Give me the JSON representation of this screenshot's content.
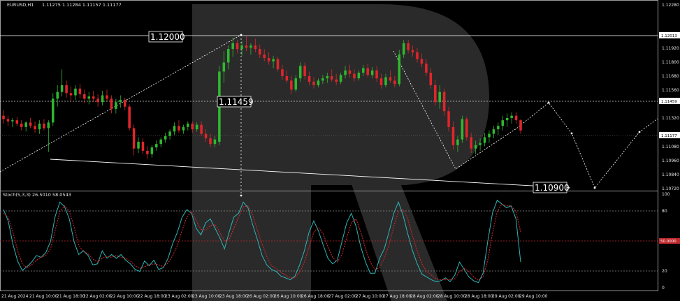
{
  "header": {
    "symbol": "EURUSD,H1",
    "ohlc": "1.11275  1.11284  1.11157  1.11177"
  },
  "indicator": {
    "label": "Stoch(5,3,3) 26.5010 58.0543"
  },
  "price_axis": {
    "ticks": [
      "1.12280",
      "1.12013",
      "1.11920",
      "1.11800",
      "1.11680",
      "1.11560",
      "1.11459",
      "1.11320",
      "1.11177",
      "1.11080",
      "1.10960",
      "1.10840",
      "1.10720"
    ]
  },
  "stoch_axis": {
    "ticks": [
      "100",
      "80",
      "50.0000",
      "20",
      "0"
    ]
  },
  "time_axis": {
    "labels": [
      "21 Aug 2024",
      "21 Aug 10:00",
      "21 Aug 18:00",
      "22 Aug 02:00",
      "22 Aug 10:00",
      "22 Aug 18:00",
      "23 Aug 02:00",
      "23 Aug 10:00",
      "23 Aug 18:00",
      "26 Aug 02:00",
      "26 Aug 10:00",
      "26 Aug 18:00",
      "27 Aug 02:00",
      "27 Aug 10:00",
      "27 Aug 18:00",
      "28 Aug 02:00",
      "28 Aug 10:00",
      "28 Aug 18:00",
      "29 Aug 02:00",
      "29 Aug 10:00"
    ]
  },
  "annotations": {
    "level_high": "1.12000",
    "level_mid": "1.11459",
    "level_low": "1.10900"
  },
  "colors": {
    "background": "#000000",
    "bull": "#2fb82f",
    "bear": "#e0262b",
    "stoch_main": "#2fb5b8",
    "stoch_signal": "#e0262b",
    "current_price_tag": "#ffffff",
    "watermark": "#2a2a2a"
  },
  "chart_data": [
    {
      "type": "candlestick",
      "title": "EURUSD,H1",
      "ylim": [
        1.1066,
        1.1232
      ],
      "levels": [
        1.12013,
        1.11459,
        1.11177
      ],
      "candles": [
        [
          1.1131,
          1.1136,
          1.1124,
          1.1128
        ],
        [
          1.1128,
          1.1131,
          1.1122,
          1.1126
        ],
        [
          1.1126,
          1.1129,
          1.1121,
          1.1127
        ],
        [
          1.1127,
          1.113,
          1.1122,
          1.1124
        ],
        [
          1.1124,
          1.1127,
          1.1118,
          1.1121
        ],
        [
          1.1121,
          1.1126,
          1.1117,
          1.1125
        ],
        [
          1.1125,
          1.1129,
          1.112,
          1.1122
        ],
        [
          1.1122,
          1.1126,
          1.1116,
          1.1119
        ],
        [
          1.1119,
          1.1127,
          1.1115,
          1.1124
        ],
        [
          1.1124,
          1.1128,
          1.1118,
          1.112
        ],
        [
          1.112,
          1.1127,
          1.1099,
          1.1125
        ],
        [
          1.1125,
          1.1151,
          1.1122,
          1.1146
        ],
        [
          1.1146,
          1.1158,
          1.1139,
          1.1152
        ],
        [
          1.1152,
          1.1172,
          1.1148,
          1.1158
        ],
        [
          1.1158,
          1.1162,
          1.1147,
          1.1151
        ],
        [
          1.1151,
          1.1157,
          1.1144,
          1.1149
        ],
        [
          1.1149,
          1.1158,
          1.1145,
          1.1155
        ],
        [
          1.1155,
          1.1159,
          1.1146,
          1.115
        ],
        [
          1.115,
          1.1154,
          1.1142,
          1.1146
        ],
        [
          1.1146,
          1.1152,
          1.1141,
          1.1148
        ],
        [
          1.1148,
          1.1153,
          1.1143,
          1.1146
        ],
        [
          1.1146,
          1.115,
          1.1139,
          1.1143
        ],
        [
          1.1143,
          1.1153,
          1.114,
          1.1149
        ],
        [
          1.1149,
          1.1154,
          1.1144,
          1.1146
        ],
        [
          1.1146,
          1.1149,
          1.1133,
          1.1137
        ],
        [
          1.1137,
          1.1146,
          1.1133,
          1.1143
        ],
        [
          1.1143,
          1.1149,
          1.1138,
          1.1145
        ],
        [
          1.1145,
          1.1147,
          1.1136,
          1.1139
        ],
        [
          1.1139,
          1.1141,
          1.1118,
          1.112
        ],
        [
          1.112,
          1.1123,
          1.1096,
          1.1102
        ],
        [
          1.1102,
          1.1112,
          1.1098,
          1.1108
        ],
        [
          1.1108,
          1.1111,
          1.1097,
          1.11
        ],
        [
          1.11,
          1.1104,
          1.1093,
          1.1097
        ],
        [
          1.1097,
          1.1105,
          1.1094,
          1.1103
        ],
        [
          1.1103,
          1.1109,
          1.11,
          1.1106
        ],
        [
          1.1106,
          1.1112,
          1.1103,
          1.111
        ],
        [
          1.111,
          1.1116,
          1.1107,
          1.1113
        ],
        [
          1.1113,
          1.1119,
          1.111,
          1.1117
        ],
        [
          1.1117,
          1.1125,
          1.1114,
          1.1122
        ],
        [
          1.1122,
          1.1127,
          1.1116,
          1.1118
        ],
        [
          1.1118,
          1.1123,
          1.1115,
          1.1121
        ],
        [
          1.1121,
          1.1126,
          1.1118,
          1.1124
        ],
        [
          1.1124,
          1.1126,
          1.1116,
          1.1119
        ],
        [
          1.1119,
          1.1125,
          1.1117,
          1.1123
        ],
        [
          1.1123,
          1.1126,
          1.1113,
          1.1115
        ],
        [
          1.1115,
          1.1119,
          1.1108,
          1.1111
        ],
        [
          1.1111,
          1.1115,
          1.1103,
          1.1106
        ],
        [
          1.1106,
          1.1113,
          1.1103,
          1.111
        ],
        [
          1.1108,
          1.1175,
          1.1105,
          1.117
        ],
        [
          1.117,
          1.1188,
          1.116,
          1.1178
        ],
        [
          1.1178,
          1.1193,
          1.1172,
          1.119
        ],
        [
          1.119,
          1.12,
          1.1183,
          1.1195
        ],
        [
          1.1195,
          1.1198,
          1.1186,
          1.119
        ],
        [
          1.119,
          1.1197,
          1.1184,
          1.1193
        ],
        [
          1.1193,
          1.1201,
          1.1188,
          1.1191
        ],
        [
          1.1191,
          1.1195,
          1.1185,
          1.1193
        ],
        [
          1.1193,
          1.1199,
          1.1187,
          1.119
        ],
        [
          1.119,
          1.1194,
          1.1182,
          1.1185
        ],
        [
          1.1185,
          1.119,
          1.1179,
          1.1182
        ],
        [
          1.1182,
          1.1187,
          1.1176,
          1.1179
        ],
        [
          1.1179,
          1.1184,
          1.1173,
          1.1181
        ],
        [
          1.1181,
          1.1183,
          1.117,
          1.1172
        ],
        [
          1.1172,
          1.1176,
          1.1163,
          1.1166
        ],
        [
          1.1166,
          1.1171,
          1.116,
          1.1162
        ],
        [
          1.1162,
          1.1166,
          1.115,
          1.1154
        ],
        [
          1.1154,
          1.1167,
          1.1152,
          1.1164
        ],
        [
          1.1164,
          1.1178,
          1.1161,
          1.1175
        ],
        [
          1.1175,
          1.1178,
          1.1163,
          1.1166
        ],
        [
          1.1166,
          1.117,
          1.1158,
          1.1161
        ],
        [
          1.1161,
          1.1165,
          1.1155,
          1.1158
        ],
        [
          1.1158,
          1.1164,
          1.1156,
          1.1162
        ],
        [
          1.1162,
          1.1167,
          1.1159,
          1.1164
        ],
        [
          1.1164,
          1.1169,
          1.116,
          1.1166
        ],
        [
          1.1166,
          1.1172,
          1.1161,
          1.1163
        ],
        [
          1.1163,
          1.1168,
          1.1158,
          1.1161
        ],
        [
          1.1161,
          1.1169,
          1.1159,
          1.1167
        ],
        [
          1.1167,
          1.1175,
          1.1164,
          1.1171
        ],
        [
          1.1171,
          1.1176,
          1.1165,
          1.1168
        ],
        [
          1.1168,
          1.1172,
          1.1161,
          1.1164
        ],
        [
          1.1164,
          1.1171,
          1.1162,
          1.1169
        ],
        [
          1.1169,
          1.1176,
          1.1166,
          1.1173
        ],
        [
          1.1173,
          1.1177,
          1.1165,
          1.1167
        ],
        [
          1.1167,
          1.1174,
          1.1164,
          1.1171
        ],
        [
          1.1171,
          1.1175,
          1.1161,
          1.1164
        ],
        [
          1.1164,
          1.1168,
          1.1155,
          1.1158
        ],
        [
          1.1158,
          1.1168,
          1.1156,
          1.1165
        ],
        [
          1.1165,
          1.1171,
          1.116,
          1.1162
        ],
        [
          1.1162,
          1.1166,
          1.1156,
          1.1159
        ],
        [
          1.1159,
          1.1189,
          1.1157,
          1.1185
        ],
        [
          1.1185,
          1.1198,
          1.1182,
          1.1195
        ],
        [
          1.1195,
          1.1198,
          1.1186,
          1.1189
        ],
        [
          1.1189,
          1.1193,
          1.1183,
          1.1187
        ],
        [
          1.1187,
          1.1191,
          1.1178,
          1.1181
        ],
        [
          1.1181,
          1.1186,
          1.1174,
          1.1177
        ],
        [
          1.1177,
          1.1181,
          1.1166,
          1.1169
        ],
        [
          1.1169,
          1.1173,
          1.1155,
          1.1158
        ],
        [
          1.1158,
          1.1163,
          1.114,
          1.1143
        ],
        [
          1.1143,
          1.1158,
          1.1137,
          1.1152
        ],
        [
          1.1152,
          1.1155,
          1.1131,
          1.1135
        ],
        [
          1.1135,
          1.1139,
          1.1117,
          1.1121
        ],
        [
          1.1121,
          1.1126,
          1.1101,
          1.1105
        ],
        [
          1.1105,
          1.1113,
          1.1099,
          1.111
        ],
        [
          1.111,
          1.1131,
          1.1107,
          1.1128
        ],
        [
          1.1128,
          1.113,
          1.1109,
          1.1112
        ],
        [
          1.1112,
          1.1116,
          1.1098,
          1.1102
        ],
        [
          1.1102,
          1.1109,
          1.1097,
          1.1105
        ],
        [
          1.1105,
          1.1111,
          1.11,
          1.1107
        ],
        [
          1.1107,
          1.1116,
          1.1104,
          1.1112
        ],
        [
          1.1112,
          1.1118,
          1.1107,
          1.1115
        ],
        [
          1.1115,
          1.1122,
          1.1111,
          1.1119
        ],
        [
          1.1119,
          1.1125,
          1.1114,
          1.1122
        ],
        [
          1.1122,
          1.1131,
          1.1118,
          1.1127
        ],
        [
          1.1127,
          1.1133,
          1.1121,
          1.1129
        ],
        [
          1.1129,
          1.1134,
          1.1124,
          1.1131
        ],
        [
          1.1131,
          1.1134,
          1.1124,
          1.1127
        ],
        [
          1.1127,
          1.1128,
          1.1115,
          1.1118
        ]
      ]
    },
    {
      "type": "line",
      "title": "Stoch(5,3,3) 26.5010 58.0543",
      "ylim": [
        0,
        100
      ],
      "levels": [
        20,
        50,
        80
      ],
      "series": [
        {
          "values": [
            82,
            70,
            45,
            27,
            17,
            21,
            26,
            33,
            31,
            36,
            48,
            75,
            90,
            85,
            72,
            48,
            34,
            38,
            33,
            23,
            24,
            38,
            30,
            34,
            30,
            34,
            28,
            24,
            18,
            16,
            27,
            22,
            28,
            18,
            20,
            30,
            46,
            58,
            74,
            82,
            78,
            62,
            55,
            68,
            72,
            62,
            52,
            40,
            58,
            74,
            78,
            90,
            84,
            66,
            50,
            33,
            23,
            18,
            16,
            11,
            9,
            7,
            11,
            23,
            38,
            58,
            70,
            59,
            44,
            30,
            24,
            28,
            48,
            68,
            78,
            64,
            42,
            26,
            14,
            14,
            30,
            40,
            58,
            78,
            90,
            76,
            56,
            38,
            24,
            13,
            10,
            7,
            5,
            6,
            9,
            5,
            12,
            26,
            18,
            10,
            6,
            4,
            14,
            48,
            78,
            92,
            88,
            84,
            86,
            72,
            26
          ]
        },
        {
          "values": [
            78,
            74,
            58,
            38,
            24,
            20,
            23,
            28,
            31,
            33,
            40,
            60,
            80,
            86,
            80,
            64,
            44,
            37,
            35,
            29,
            26,
            30,
            32,
            31,
            33,
            31,
            30,
            27,
            22,
            19,
            21,
            23,
            24,
            23,
            21,
            25,
            33,
            44,
            60,
            74,
            80,
            70,
            61,
            60,
            65,
            66,
            58,
            48,
            50,
            62,
            74,
            85,
            86,
            76,
            60,
            45,
            32,
            22,
            19,
            15,
            12,
            9,
            9,
            15,
            26,
            42,
            58,
            63,
            56,
            42,
            31,
            26,
            34,
            52,
            68,
            72,
            58,
            40,
            26,
            18,
            20,
            30,
            44,
            64,
            80,
            82,
            72,
            54,
            38,
            24,
            16,
            12,
            8,
            7,
            7,
            7,
            8,
            16,
            19,
            16,
            10,
            7,
            10,
            28,
            56,
            80,
            88,
            86,
            86,
            80,
            58
          ]
        }
      ]
    }
  ]
}
